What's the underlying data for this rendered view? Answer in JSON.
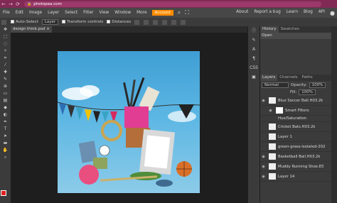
{
  "browser": {
    "url": "photopea.com"
  },
  "menubar": {
    "items": [
      "File",
      "Edit",
      "Image",
      "Layer",
      "Select",
      "Filter",
      "View",
      "Window",
      "More"
    ],
    "account_label": "Account",
    "right_items": [
      "About",
      "Report a bug",
      "Learn",
      "Blog",
      "API"
    ]
  },
  "options": {
    "auto_select_label": "Auto-Select",
    "auto_select_target": "Layer",
    "transform_controls_label": "Transform controls",
    "distances_label": "Distances"
  },
  "document": {
    "tab_name": "design think.psd"
  },
  "history_panel": {
    "tabs": [
      "History",
      "Swatches"
    ],
    "items": [
      "Open"
    ]
  },
  "layers_panel": {
    "tabs": [
      "Layers",
      "Channels",
      "Paths"
    ],
    "blend_mode": "Normal",
    "opacity_label": "Opacity:",
    "opacity_value": "100%",
    "fill_label": "Fill:",
    "fill_value": "100%",
    "layers": [
      {
        "name": "Blue Soccer Ball.H03.2k"
      },
      {
        "name": "Smart Filters"
      },
      {
        "name": "Hue/Saturation"
      },
      {
        "name": "Cricket Bats.H03.2k"
      },
      {
        "name": "Layer 1"
      },
      {
        "name": "green-grass-isolated-202"
      },
      {
        "name": "Basketball Ball.H03.2k"
      },
      {
        "name": "Muddy Running Shoe.E0"
      },
      {
        "name": "Layer 14"
      }
    ]
  },
  "colors": {
    "browser_bar": "#802a55",
    "accent": "#ff8c00",
    "foreground": "#e02020"
  }
}
